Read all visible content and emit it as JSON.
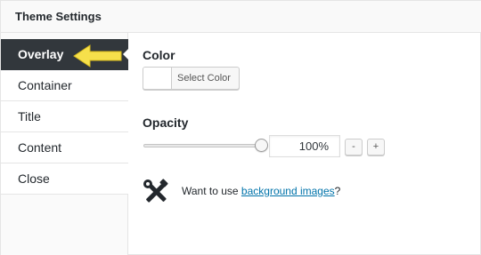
{
  "panel": {
    "title": "Theme Settings"
  },
  "sidebar": {
    "active": "Overlay",
    "items": [
      {
        "label": "Overlay"
      },
      {
        "label": "Container"
      },
      {
        "label": "Title"
      },
      {
        "label": "Content"
      },
      {
        "label": "Close"
      }
    ]
  },
  "color": {
    "label": "Color",
    "button_label": "Select Color",
    "current_value": "#ffffff"
  },
  "opacity": {
    "label": "Opacity",
    "value": "100%",
    "level": 1.0,
    "decrement_label": "-",
    "increment_label": "+"
  },
  "background_note": {
    "prefix": "Want to use ",
    "link_text": "background images",
    "suffix": "?"
  },
  "icons": {
    "arrow": "arrow-left-icon",
    "tools": "tools-icon"
  },
  "colors": {
    "active_tab": "#32373c",
    "arrow": "#f6e04b",
    "link": "#0073aa"
  }
}
